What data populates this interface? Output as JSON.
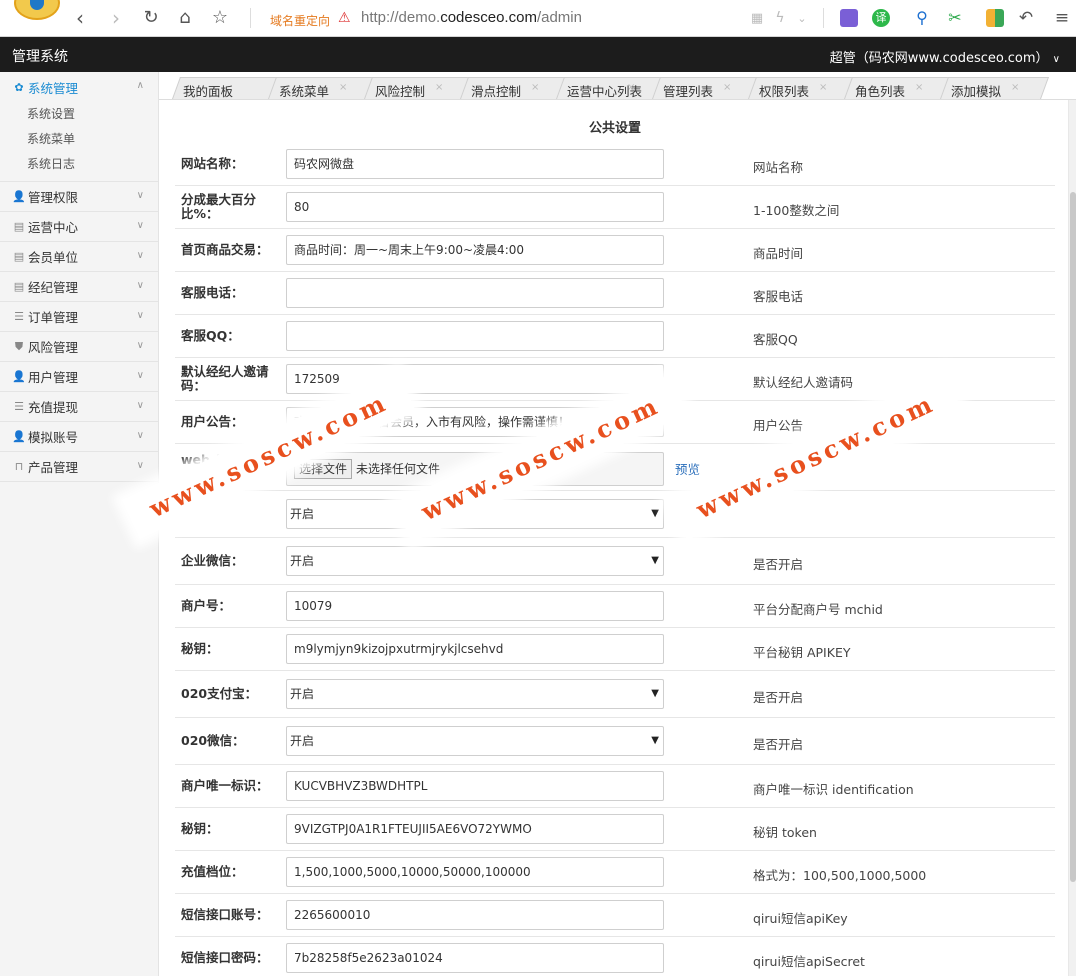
{
  "browser": {
    "redirect_label": "域名重定向",
    "url_prefix": "http://demo.",
    "url_domain": "codesceo.com",
    "url_path": "/admin"
  },
  "header": {
    "title": "管理系统",
    "user": "超管（码农网www.codesceo.com）"
  },
  "sidebar": {
    "active": {
      "label": "系统管理",
      "icon": "gear-icon"
    },
    "subitems": [
      "系统设置",
      "系统菜单",
      "系统日志"
    ],
    "items": [
      {
        "label": "管理权限",
        "icon": "user-icon"
      },
      {
        "label": "运营中心",
        "icon": "grid-icon"
      },
      {
        "label": "会员单位",
        "icon": "grid-icon"
      },
      {
        "label": "经纪管理",
        "icon": "grid-icon"
      },
      {
        "label": "订单管理",
        "icon": "list-icon"
      },
      {
        "label": "风险管理",
        "icon": "shield-icon"
      },
      {
        "label": "用户管理",
        "icon": "user-icon"
      },
      {
        "label": "充值提现",
        "icon": "list-icon"
      },
      {
        "label": "模拟账号",
        "icon": "user-icon"
      },
      {
        "label": "产品管理",
        "icon": "bag-icon"
      }
    ]
  },
  "tabs": [
    "我的面板",
    "系统菜单",
    "风险控制",
    "滑点控制",
    "运营中心列表",
    "管理列表",
    "权限列表",
    "角色列表",
    "添加模拟"
  ],
  "form": {
    "title": "公共设置",
    "rows": [
      {
        "label": "网站名称：",
        "value": "码农网微盘",
        "desc": "网站名称",
        "type": "text"
      },
      {
        "label": "分成最大百分比%：",
        "value": "80",
        "desc": "1-100整数之间",
        "type": "text"
      },
      {
        "label": "首页商品交易：",
        "value": "商品时间：周一~周末上午9:00~凌晨4:00",
        "desc": "商品时间",
        "type": "text"
      },
      {
        "label": "客服电话：",
        "value": "",
        "desc": "客服电话",
        "type": "text"
      },
      {
        "label": "客服QQ：",
        "value": "",
        "desc": "客服QQ",
        "type": "text"
      },
      {
        "label": "默认经纪人邀请码：",
        "value": "172509",
        "desc": "默认经纪人邀请码",
        "type": "text"
      },
      {
        "label": "用户公告：",
        "value": "欢迎您成为本平台会员，入市有风险，操作需谨慎！",
        "desc": "用户公告",
        "type": "text"
      },
      {
        "label": "web_logo：",
        "value": "未选择任何文件",
        "button": "选择文件",
        "link": "预览",
        "desc": "web_logo",
        "type": "file"
      },
      {
        "label": "",
        "value": "开启",
        "desc": "",
        "type": "select"
      },
      {
        "label": "企业微信：",
        "value": "开启",
        "desc": "是否开启",
        "type": "select"
      },
      {
        "label": "商户号：",
        "value": "10079",
        "desc": "平台分配商户号 mchid",
        "type": "text"
      },
      {
        "label": "秘钥：",
        "value": "m9lymjyn9kizojpxutrmjrykjlcsehvd",
        "desc": "平台秘钥 APIKEY",
        "type": "text"
      },
      {
        "label": "020支付宝：",
        "value": "开启",
        "desc": "是否开启",
        "type": "select"
      },
      {
        "label": "020微信：",
        "value": "开启",
        "desc": "是否开启",
        "type": "select"
      },
      {
        "label": "商户唯一标识：",
        "value": "KUCVBHVZ3BWDHTPL",
        "desc": "商户唯一标识 identification",
        "type": "text"
      },
      {
        "label": "秘钥：",
        "value": "9VIZGTPJ0A1R1FTEUJII5AE6VO72YWMO",
        "desc": "秘钥 token",
        "type": "text"
      },
      {
        "label": "充值档位：",
        "value": "1,500,1000,5000,10000,50000,100000",
        "desc": "格式为：100,500,1000,5000",
        "type": "text"
      },
      {
        "label": "短信接口账号：",
        "value": "2265600010",
        "desc": "qirui短信apiKey",
        "type": "text"
      },
      {
        "label": "短信接口密码：",
        "value": "7b28258f5e2623a01024",
        "desc": "qirui短信apiSecret",
        "type": "text"
      }
    ]
  },
  "watermark": "www.soscw.com"
}
